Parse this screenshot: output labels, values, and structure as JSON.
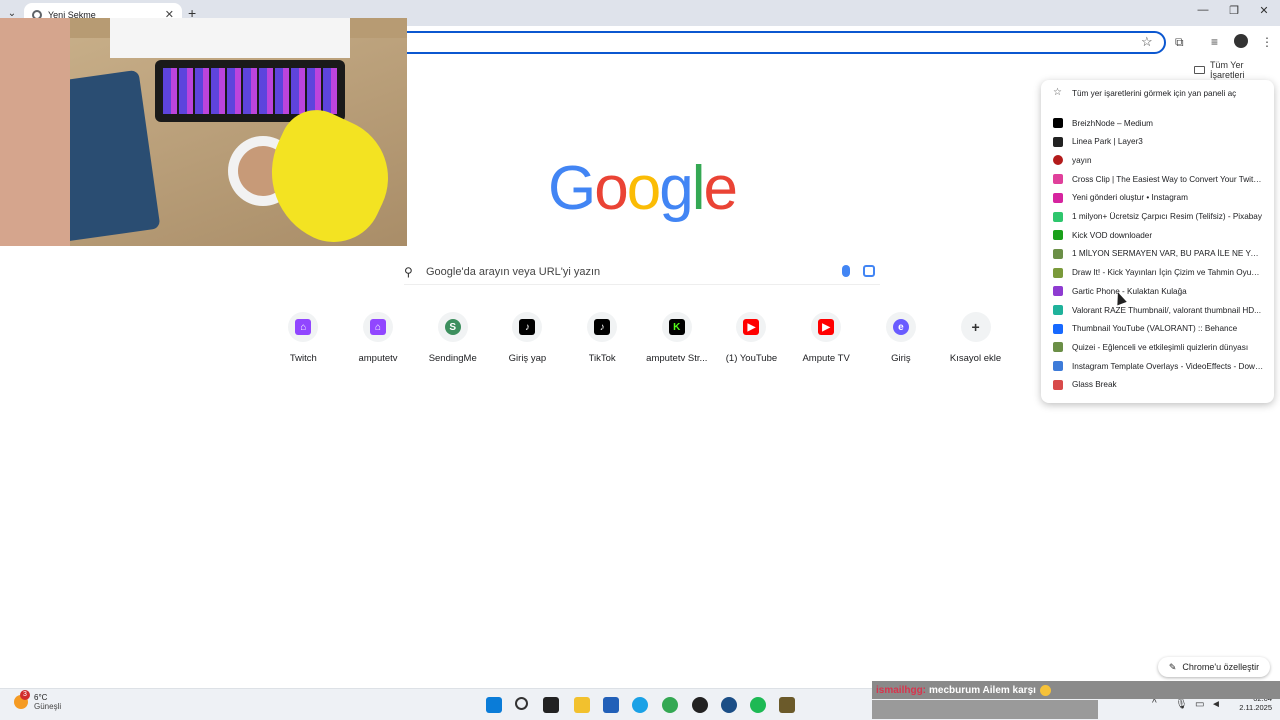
{
  "browser": {
    "tab_title": "Yeni Sekme",
    "all_bookmarks_label": "Tüm Yer İşaretleri"
  },
  "google": {
    "logo_letters": [
      {
        "char": "G",
        "color": "#4285f4"
      },
      {
        "char": "o",
        "color": "#ea4335"
      },
      {
        "char": "o",
        "color": "#fbbc05"
      },
      {
        "char": "g",
        "color": "#4285f4"
      },
      {
        "char": "l",
        "color": "#34a853"
      },
      {
        "char": "e",
        "color": "#ea4335"
      }
    ],
    "search_placeholder": "Google'da arayın veya URL'yi yazın"
  },
  "shortcuts": [
    {
      "label": "Twitch",
      "icon": "twitch-icon",
      "color": "#9146ff",
      "glyph": "⌂"
    },
    {
      "label": "amputetv",
      "icon": "twitch-icon",
      "color": "#9146ff",
      "glyph": "⌂"
    },
    {
      "label": "SendingMe",
      "icon": "sendingme-icon",
      "color": "#3d8f5e",
      "glyph": "S"
    },
    {
      "label": "Giriş yap",
      "icon": "tiktok-icon",
      "color": "#000000",
      "glyph": "♪"
    },
    {
      "label": "TikTok",
      "icon": "tiktok-icon",
      "color": "#000000",
      "glyph": "♪"
    },
    {
      "label": "amputetv Str...",
      "icon": "kick-icon",
      "color": "#000000",
      "glyph": "K"
    },
    {
      "label": "(1) YouTube",
      "icon": "youtube-icon",
      "color": "#ff0000",
      "glyph": "▶"
    },
    {
      "label": "Ampute TV",
      "icon": "youtube-icon",
      "color": "#ff0000",
      "glyph": "▶"
    },
    {
      "label": "Giriş",
      "icon": "edge-icon",
      "color": "#6a5cff",
      "glyph": "e"
    },
    {
      "label": "Kısayol ekle",
      "icon": "plus-icon",
      "color": "#f1f3f4",
      "glyph": "+"
    }
  ],
  "bookmarks_menu": {
    "open_panel_label": "Tüm yer işaretlerini görmek için yan paneli aç",
    "items": [
      {
        "label": "BreizhNode – Medium",
        "icon": "medium-icon",
        "color": "#000000"
      },
      {
        "label": "Linea Park | Layer3",
        "icon": "layer3-icon",
        "color": "#222222"
      },
      {
        "label": "yayın",
        "icon": "record-icon",
        "color": "#b31b1b"
      },
      {
        "label": "Cross Clip | The Easiest Way to Convert Your Twitch...",
        "icon": "crossclip-icon",
        "color": "#e0409b"
      },
      {
        "label": "Yeni gönderi oluştur • Instagram",
        "icon": "instagram-icon",
        "color": "#d6249f"
      },
      {
        "label": "1 milyon+ Ücretsiz Çarpıcı Resim (Telifsiz) - Pixabay",
        "icon": "pixabay-icon",
        "color": "#2ec66d"
      },
      {
        "label": "Kick VOD downloader",
        "icon": "kick-icon",
        "color": "#1aa01a"
      },
      {
        "label": "1 MİLYON SERMAYEN VAR, BU PARA İLE NE YAPARSI...",
        "icon": "site-icon",
        "color": "#6b8f47"
      },
      {
        "label": "Draw It! - Kick Yayınları İçin Çizim ve Tahmin Oyunu...",
        "icon": "drawit-icon",
        "color": "#7a9a3a"
      },
      {
        "label": "Gartic Phone - Kulaktan Kulağa",
        "icon": "gartic-icon",
        "color": "#8e3bd1"
      },
      {
        "label": "Valorant RAZE Thumbnail/, valorant thumbnail HD...",
        "icon": "valorant-icon",
        "color": "#1fb29b"
      },
      {
        "label": "Thumbnail YouTube (VALORANT) :: Behance",
        "icon": "behance-icon",
        "color": "#1769ff"
      },
      {
        "label": "Quizei - Eğlenceli ve etkileşimli quizlerin dünyası",
        "icon": "quizei-icon",
        "color": "#6b8f47"
      },
      {
        "label": "Instagram Template Overlays - VideoEffects - Downl...",
        "icon": "videoeffects-icon",
        "color": "#3d7bd9"
      },
      {
        "label": "Glass Break",
        "icon": "glassbreak-icon",
        "color": "#d84a4a"
      }
    ]
  },
  "customize_label": "Chrome'u özelleştir",
  "chat": {
    "user": "ismailhgg:",
    "message": "mecburum Ailem karşı"
  },
  "taskbar": {
    "weather_badge": "3",
    "temperature": "6°C",
    "condition": "Güneşli",
    "time": "02:04",
    "date": "2.11.2025"
  }
}
